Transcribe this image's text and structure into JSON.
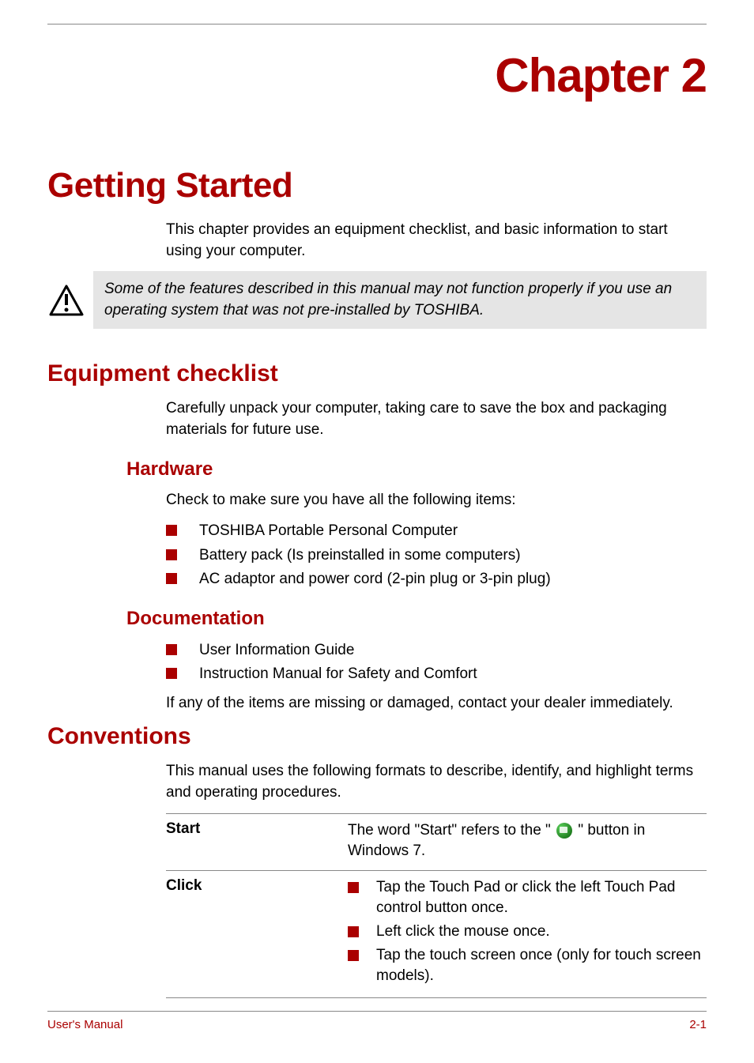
{
  "chapter_title": "Chapter 2",
  "main_heading": "Getting Started",
  "intro_text": "This chapter provides an equipment checklist, and basic information to start using your computer.",
  "warning_text": "Some of the features described in this manual may not function properly if you use an operating system that was not pre-installed by TOSHIBA.",
  "sections": {
    "equipment": {
      "heading": "Equipment checklist",
      "intro": "Carefully unpack your computer, taking care to save the box and packaging materials for future use.",
      "hardware": {
        "heading": "Hardware",
        "intro": "Check to make sure you have all the following items:",
        "items": [
          "TOSHIBA Portable Personal Computer",
          "Battery pack (Is preinstalled in some computers)",
          "AC adaptor and power cord (2-pin plug or 3-pin plug)"
        ]
      },
      "documentation": {
        "heading": "Documentation",
        "items": [
          "User Information Guide",
          "Instruction Manual for Safety and Comfort"
        ],
        "note": "If any of the items are missing or damaged, contact your dealer immediately."
      }
    },
    "conventions": {
      "heading": "Conventions",
      "intro": "This manual uses the following formats to describe, identify, and highlight terms and operating procedures.",
      "rows": [
        {
          "term": "Start",
          "def_prefix": "The word \"Start\" refers to the \" ",
          "def_suffix": " \" button in Windows 7."
        },
        {
          "term": "Click",
          "bullets": [
            "Tap the Touch Pad or click the left Touch Pad control button once.",
            "Left click the mouse once.",
            "Tap the touch screen once (only for touch screen models)."
          ]
        }
      ]
    }
  },
  "footer": {
    "left": "User's Manual",
    "right": "2-1"
  }
}
